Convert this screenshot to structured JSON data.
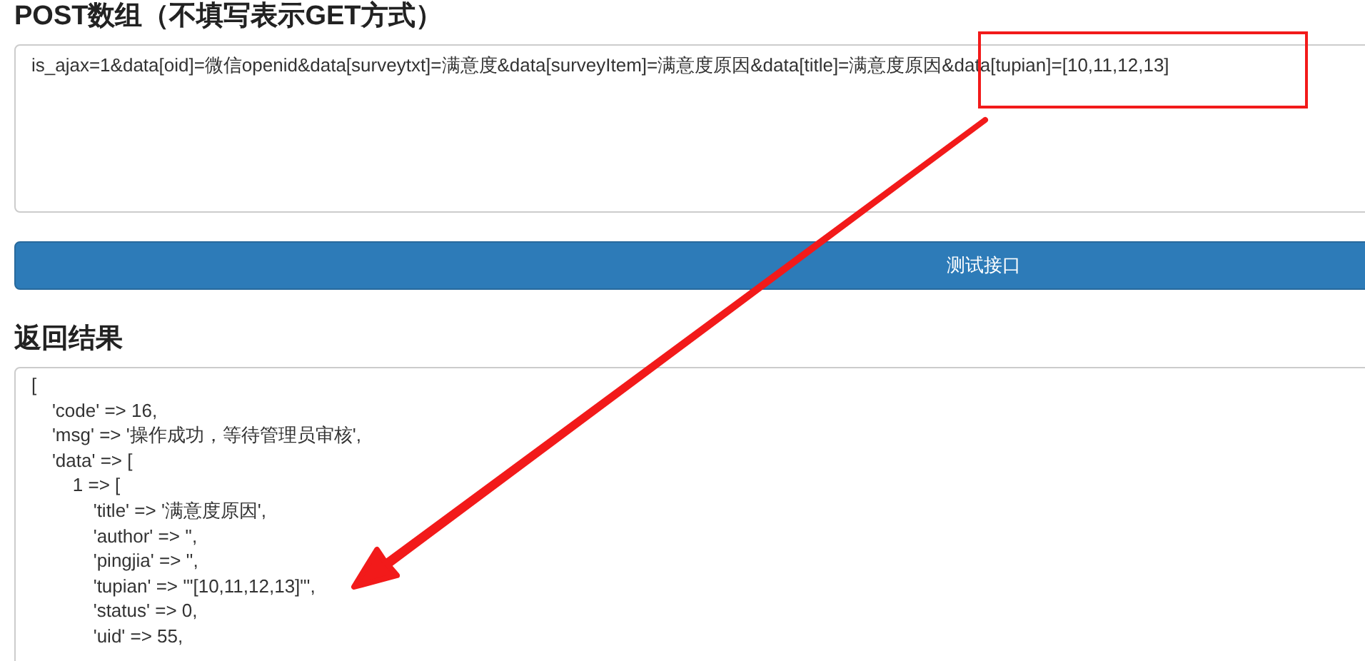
{
  "post_section": {
    "title": "POST数组（不填写表示GET方式）",
    "value": "is_ajax=1&data[oid]=微信openid&data[surveytxt]=满意度&data[surveyItem]=满意度原因&data[title]=满意度原因&data[tupian]=[10,11,12,13]"
  },
  "submit_button": {
    "label": "测试接口"
  },
  "result_section": {
    "title": "返回结果",
    "lines": [
      "[",
      "    'code' => 16,",
      "    'msg' => '操作成功，等待管理员审核',",
      "    'data' => [",
      "        1 => [",
      "            'title' => '满意度原因',",
      "            'author' => '',",
      "            'pingjia' => '',",
      "            'tupian' => '\"[10,11,12,13]\"',",
      "            'status' => 0,",
      "            'uid' => 55,"
    ]
  }
}
